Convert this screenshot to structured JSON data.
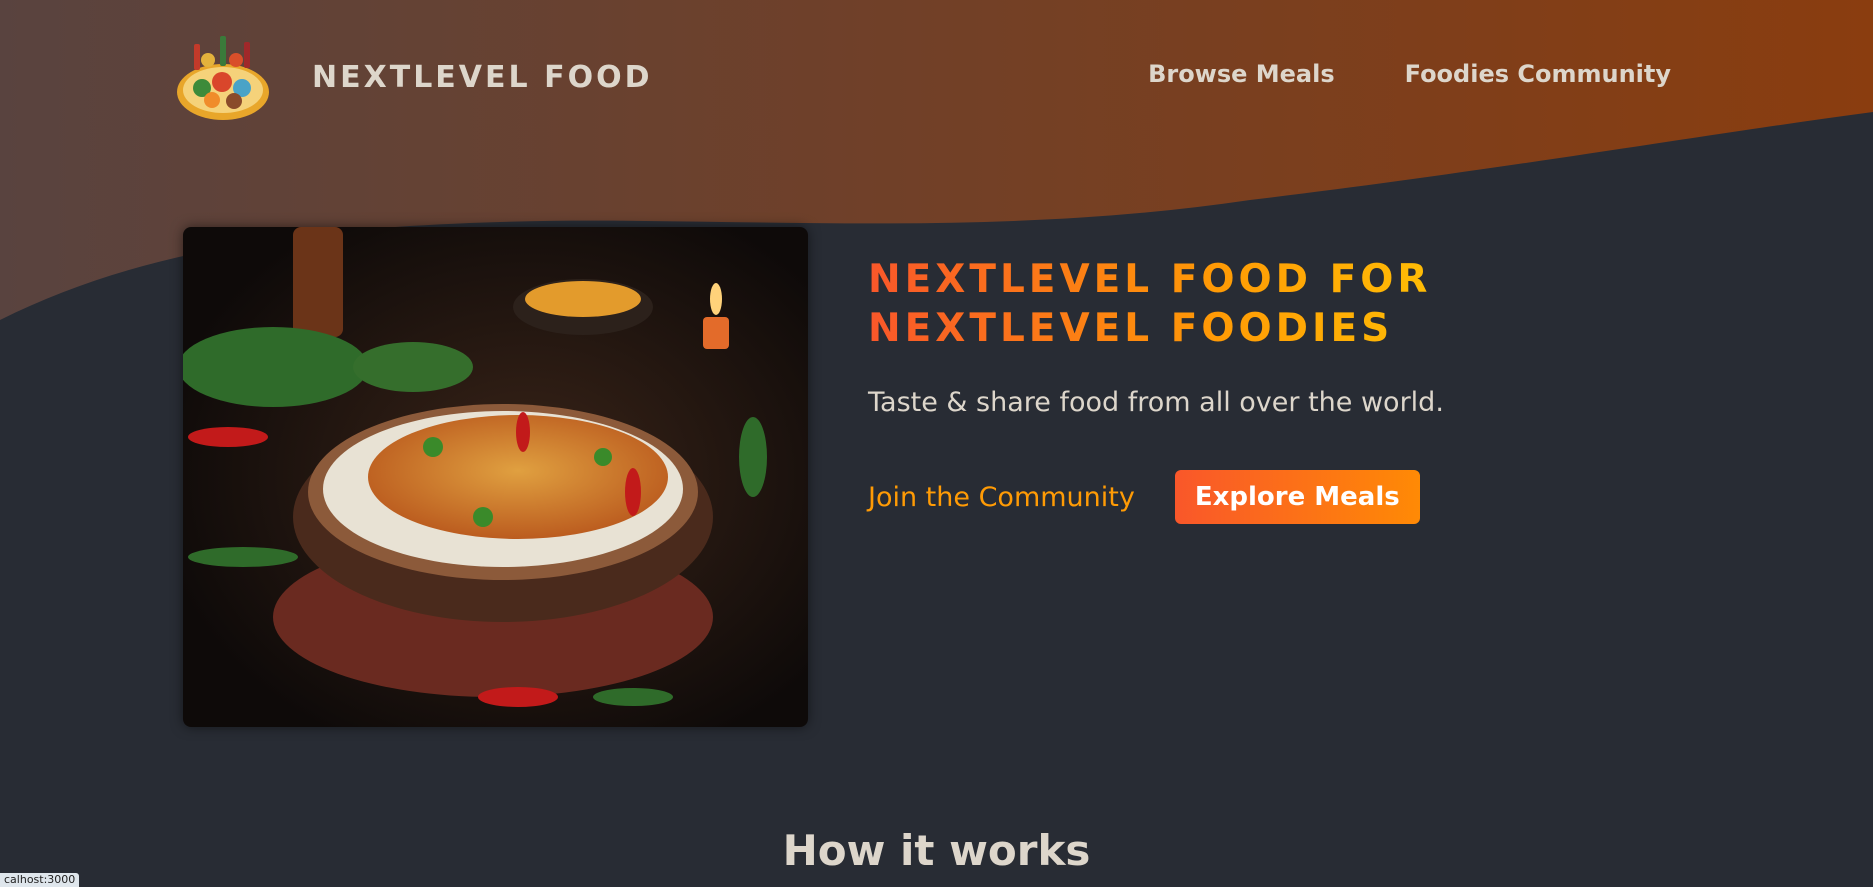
{
  "header": {
    "brand": "NEXTLEVEL FOOD",
    "nav": [
      {
        "label": "Browse Meals"
      },
      {
        "label": "Foodies Community"
      }
    ]
  },
  "hero": {
    "title": "NEXTLEVEL FOOD FOR NEXTLEVEL FOODIES",
    "tagline": "Taste & share food from all over the world.",
    "join_label": "Join the Community",
    "explore_label": "Explore Meals"
  },
  "section": {
    "title": "How it works"
  },
  "status": {
    "url_text": "calhost:3000"
  },
  "colors": {
    "background": "#282c34",
    "accent_start": "#f9572a",
    "accent_end": "#ff9b05",
    "text": "#ddd6cb"
  }
}
